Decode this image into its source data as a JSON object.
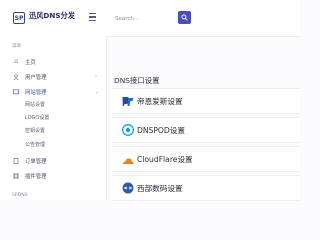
{
  "brand": {
    "logo_text": "SP",
    "name": "迅风DNS分发"
  },
  "search": {
    "placeholder": "Search..."
  },
  "sidebar": {
    "section1": "菜单",
    "items": [
      {
        "label": "主页"
      },
      {
        "label": "用户管理"
      },
      {
        "label": "网站管理"
      }
    ],
    "subitems": [
      {
        "label": "网站设置"
      },
      {
        "label": "LOGO设置"
      },
      {
        "label": "密钥设置"
      },
      {
        "label": "公告管理"
      }
    ],
    "items2": [
      {
        "label": "订单管理"
      },
      {
        "label": "插件管理"
      }
    ],
    "section2": "SPDNS"
  },
  "main": {
    "title": "DNS接口设置",
    "providers": [
      {
        "name": "帝恩爱斯设置",
        "icon": "dns-logo-icon"
      },
      {
        "name": "DNSPOD设置",
        "icon": "dnspod-logo-icon"
      },
      {
        "name": "CloudFlare设置",
        "icon": "cloudflare-logo-icon"
      },
      {
        "name": "西部数码设置",
        "icon": "west-logo-icon"
      }
    ]
  }
}
